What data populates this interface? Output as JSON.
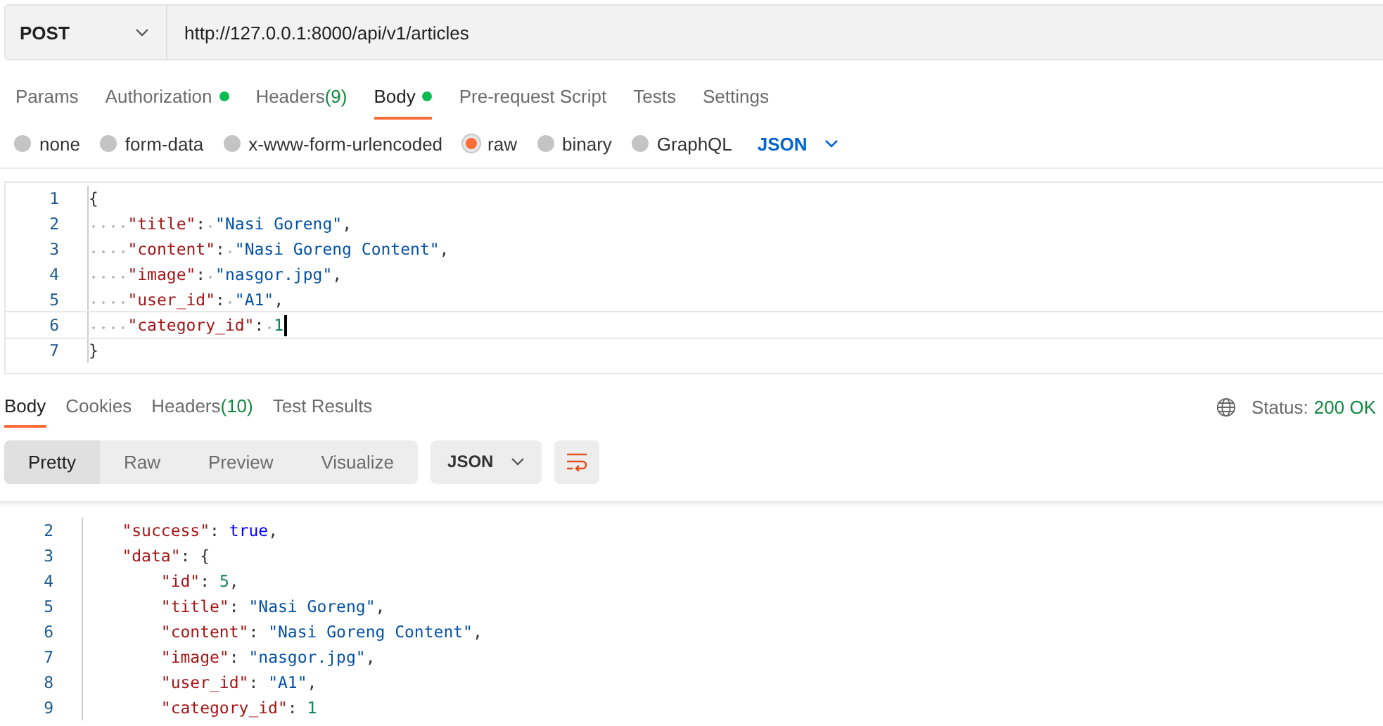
{
  "request": {
    "method": "POST",
    "url": "http://127.0.0.1:8000/api/v1/articles"
  },
  "tabs": [
    {
      "label": "Params",
      "selected": false
    },
    {
      "label": "Authorization",
      "selected": false,
      "dot": true
    },
    {
      "label": "Headers",
      "count": "(9)",
      "selected": false
    },
    {
      "label": "Body",
      "selected": true,
      "dot": true
    },
    {
      "label": "Pre-request Script",
      "selected": false
    },
    {
      "label": "Tests",
      "selected": false
    },
    {
      "label": "Settings",
      "selected": false
    }
  ],
  "body_types": [
    {
      "label": "none",
      "selected": false
    },
    {
      "label": "form-data",
      "selected": false
    },
    {
      "label": "x-www-form-urlencoded",
      "selected": false
    },
    {
      "label": "raw",
      "selected": true
    },
    {
      "label": "binary",
      "selected": false
    },
    {
      "label": "GraphQL",
      "selected": false
    }
  ],
  "format": "JSON",
  "request_body": [
    {
      "number": "1",
      "current": false,
      "text": "{"
    },
    {
      "number": "2",
      "current": false,
      "text": "    \"title\": \"Nasi Goreng\","
    },
    {
      "number": "3",
      "current": false,
      "text": "    \"content\": \"Nasi Goreng Content\","
    },
    {
      "number": "4",
      "current": false,
      "text": "    \"image\": \"nasgor.jpg\","
    },
    {
      "number": "5",
      "current": false,
      "text": "    \"user_id\": \"A1\","
    },
    {
      "number": "6",
      "current": true,
      "text": "    \"category_id\": 1"
    },
    {
      "number": "7",
      "current": false,
      "text": "}"
    }
  ],
  "response_tabs": [
    {
      "label": "Body",
      "selected": true
    },
    {
      "label": "Cookies",
      "selected": false
    },
    {
      "label": "Headers",
      "count": "(10)",
      "selected": false
    },
    {
      "label": "Test Results",
      "selected": false
    }
  ],
  "status": {
    "label": "Status:",
    "value": "200 OK"
  },
  "view_modes": [
    {
      "label": "Pretty",
      "selected": true
    },
    {
      "label": "Raw",
      "selected": false
    },
    {
      "label": "Preview",
      "selected": false
    },
    {
      "label": "Visualize",
      "selected": false
    }
  ],
  "response_format": "JSON",
  "response_body": [
    {
      "number": "2",
      "text": "    \"success\": true,"
    },
    {
      "number": "3",
      "text": "    \"data\": {"
    },
    {
      "number": "4",
      "text": "        \"id\": 5,"
    },
    {
      "number": "5",
      "text": "        \"title\": \"Nasi Goreng\","
    },
    {
      "number": "6",
      "text": "        \"content\": \"Nasi Goreng Content\","
    },
    {
      "number": "7",
      "text": "        \"image\": \"nasgor.jpg\","
    },
    {
      "number": "8",
      "text": "        \"user_id\": \"A1\","
    },
    {
      "number": "9",
      "text": "        \"category_id\": 1"
    }
  ]
}
